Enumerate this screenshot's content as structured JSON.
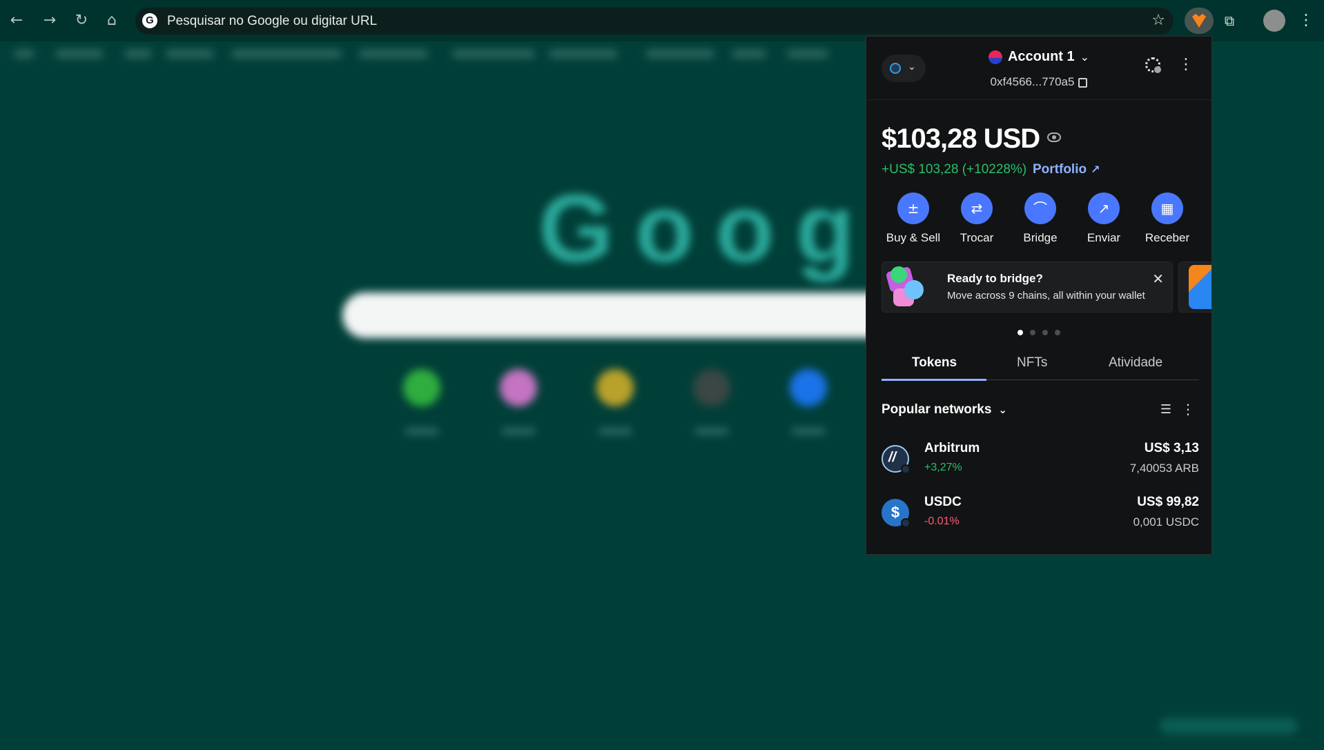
{
  "browser": {
    "omnibox_placeholder": "Pesquisar no Google ou digitar URL"
  },
  "wallet": {
    "account_name": "Account 1",
    "address": "0xf4566...770a5",
    "balance": "$103,28 USD",
    "change": "+US$ 103,28 (+10228%)",
    "portfolio_label": "Portfolio",
    "actions": [
      {
        "label": "Buy & Sell",
        "icon": "buy-sell-icon"
      },
      {
        "label": "Trocar",
        "icon": "swap-icon"
      },
      {
        "label": "Bridge",
        "icon": "bridge-icon"
      },
      {
        "label": "Enviar",
        "icon": "send-icon"
      },
      {
        "label": "Receber",
        "icon": "receive-icon"
      }
    ],
    "banner": {
      "title": "Ready to bridge?",
      "subtitle": "Move across 9 chains, all within your wallet"
    },
    "carousel_pages": 4,
    "carousel_active": 1,
    "tabs": [
      "Tokens",
      "NFTs",
      "Atividade"
    ],
    "active_tab": "Tokens",
    "network_filter": "Popular networks",
    "tokens": [
      {
        "name": "Arbitrum",
        "change": "+3,27%",
        "fiat": "US$ 3,13",
        "quantity": "7,40053 ARB",
        "trend": "up"
      },
      {
        "name": "USDC",
        "change": "-0.01%",
        "fiat": "US$ 99,82",
        "quantity": "0,001 USDC",
        "trend": "down"
      }
    ],
    "colors": {
      "accent": "#4a77ff",
      "positive": "#28c06a",
      "negative": "#ff5c78",
      "link": "#8fb3ff"
    }
  }
}
